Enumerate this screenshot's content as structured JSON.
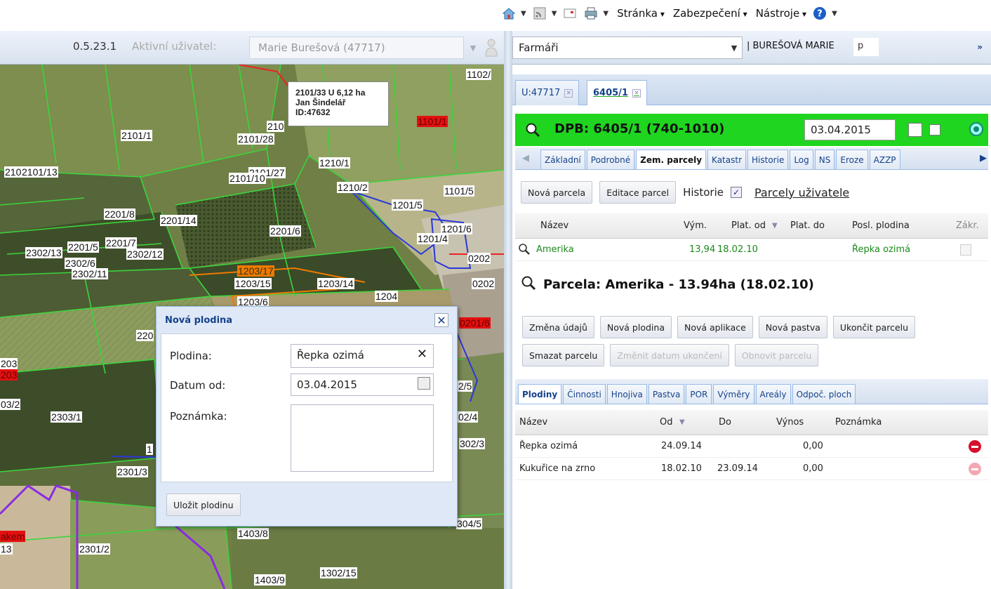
{
  "browser": {
    "menus": [
      "Stránka",
      "Zabezpečení",
      "Nástroje"
    ]
  },
  "map": {
    "version": "0.5.23.1",
    "active_user_label": "Aktivní uživatel:",
    "active_user_value": "Marie Burešová (47717)",
    "tooltip": {
      "line1": "2101/33 U 6,12 ha",
      "line2": "Jan Šindelář",
      "line3": "ID:47632"
    },
    "labels": [
      "1102/",
      "2101/1",
      "2101/28",
      "210",
      "1101/1",
      "1210/1",
      "210",
      "2101/13",
      "2101/27",
      "2101/10",
      "1210/2",
      "1101/5",
      "1201/5",
      "2201/8",
      "2201/14",
      "2201/6",
      "1201/6",
      "1201/4",
      "2302/13",
      "2201/5",
      "2201/7",
      "2302/12",
      "2302/6",
      "2302/11",
      "1203/17",
      "1203/15",
      "1203/14",
      "1204",
      "1203/6",
      "0202",
      "0202",
      "0201/6",
      "220",
      "203",
      "203",
      "03/2",
      "2303/1",
      "2/5",
      "02/4",
      "302/3",
      "2301/3",
      "1",
      "304/5",
      "1403/8",
      "akem",
      "13",
      "2301/2",
      "1403/9",
      "1302/15"
    ]
  },
  "dialog": {
    "title": "Nová plodina",
    "crop_label": "Plodina:",
    "crop_value": "Řepka ozimá",
    "date_label": "Datum od:",
    "date_value": "03.04.2015",
    "note_label": "Poznámka:",
    "save_button": "Uložit plodinu"
  },
  "panel": {
    "combo_value": "Farmáři",
    "owner": "| BUREŠOVÁ MARIE",
    "p_value": "p",
    "expand": "»",
    "tabs": [
      {
        "label": "U:47717"
      },
      {
        "label": "6405/1"
      }
    ],
    "dpb_title": "DPB: 6405/1 (740-1010)",
    "dpb_date": "03.04.2015",
    "detail_tabs": [
      "Základní",
      "Podrobné",
      "Zem. parcely",
      "Katastr",
      "Historie",
      "Log",
      "NS",
      "Eroze",
      "AZZP"
    ],
    "toolbar": {
      "new_parcel": "Nová parcela",
      "edit_parcels": "Editace parcel",
      "history_label": "Historie",
      "user_parcels": "Parcely uživatele"
    },
    "grid1": {
      "columns": [
        "Název",
        "Vým.",
        "Plat. od",
        "Plat. do",
        "Posl. plodina",
        "Zákr."
      ],
      "rows": [
        {
          "name": "Amerika",
          "area": "13,94",
          "from": "18.02.10",
          "to": "",
          "crop": "Řepka ozimá"
        }
      ]
    },
    "parcel_title": "Parcela: Amerika - 13.94ha (18.02.10)",
    "actions_row1": [
      "Změna údajů",
      "Nová plodina",
      "Nová aplikace",
      "Nová pastva",
      "Ukončit parcelu"
    ],
    "actions_row2": [
      "Smazat parcelu",
      "Změnit datum ukončení",
      "Obnovit parcelu"
    ],
    "sub_tabs": [
      "Plodiny",
      "Činnosti",
      "Hnojiva",
      "Pastva",
      "POR",
      "Výměry",
      "Areály",
      "Odpoč. ploch"
    ],
    "grid2": {
      "columns": [
        "Název",
        "Od",
        "Do",
        "Výnos",
        "Poznámka"
      ],
      "rows": [
        {
          "name": "Řepka ozimá",
          "from": "24.09.14",
          "to": "",
          "yield": "0,00",
          "note": ""
        },
        {
          "name": "Kukuřice na zrno",
          "from": "18.02.10",
          "to": "23.09.14",
          "yield": "0,00",
          "note": ""
        }
      ]
    }
  },
  "colors": {
    "accent_green": "#1fd51f",
    "ext_blue": "#15428b",
    "remove_red": "#d6102d"
  }
}
